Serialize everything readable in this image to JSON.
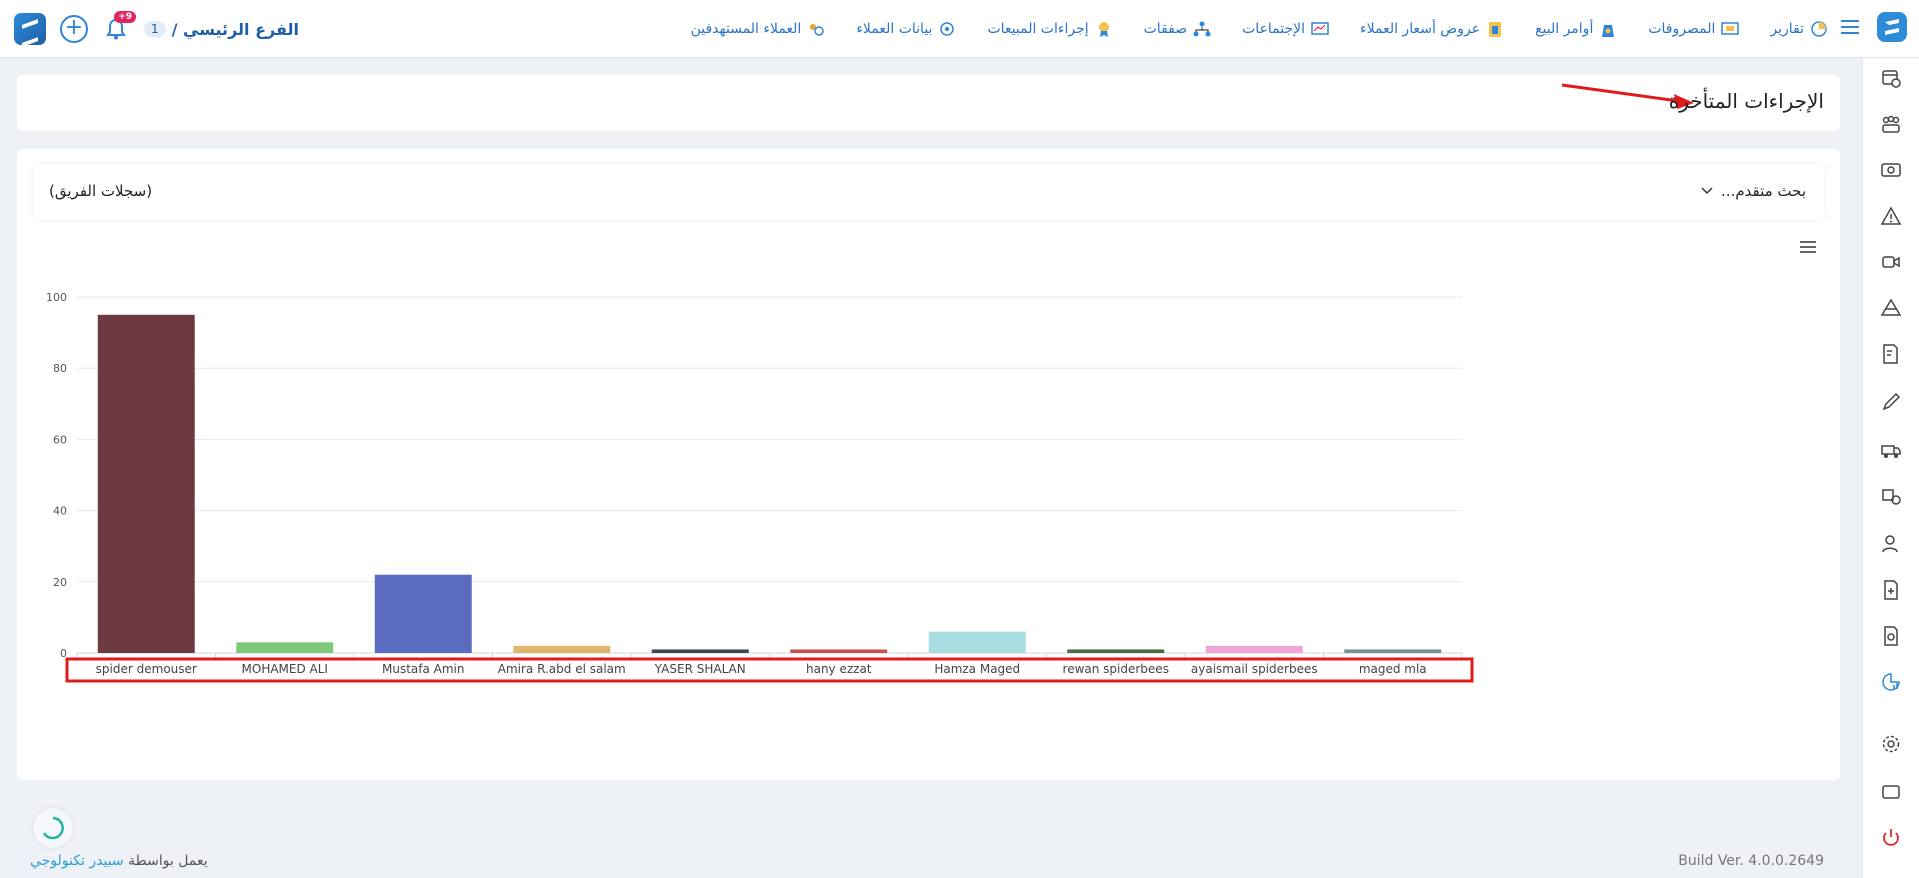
{
  "header": {
    "branch_name": "الفرع الرئيسي /",
    "branch_count": "1",
    "notification_count": "+9",
    "nav": [
      {
        "label": "العملاء المستهدفين",
        "icon": "target-customers-icon"
      },
      {
        "label": "بيانات العملاء",
        "icon": "customer-data-icon"
      },
      {
        "label": "إجراءات المبيعات",
        "icon": "sales-actions-icon"
      },
      {
        "label": "صفقات",
        "icon": "deals-icon"
      },
      {
        "label": "الإجتماعات",
        "icon": "meetings-icon"
      },
      {
        "label": "عروض أسعار العملاء",
        "icon": "quotes-icon"
      },
      {
        "label": "أوامر البيع",
        "icon": "sales-orders-icon"
      },
      {
        "label": "المصروفات",
        "icon": "expenses-icon"
      },
      {
        "label": "تقارير",
        "icon": "reports-icon"
      }
    ]
  },
  "page": {
    "title": "الإجراءات المتأخرة",
    "advanced_search": "بحث متقدم...",
    "team_records": "(سجلات الفريق)"
  },
  "colors": {
    "primary": "#2f86d6",
    "highlight": "#e11b1b"
  },
  "chart_data": {
    "type": "bar",
    "categories": [
      "spider demouser",
      "MOHAMED ALI",
      "Mustafa Amin",
      "Amira R.abd el salam",
      "YASER SHALAN",
      "hany ezzat",
      "Hamza Maged",
      "rewan spiderbees",
      "ayaismail spiderbees",
      "maged mla"
    ],
    "values": [
      95,
      3,
      22,
      2,
      1,
      1,
      6,
      1,
      2,
      1
    ],
    "colors": [
      "#6e3a42",
      "#7fca7a",
      "#5b6bbf",
      "#e0b66d",
      "#3d4650",
      "#c5534d",
      "#a8dde2",
      "#4c6a3e",
      "#efa6d6",
      "#7c9090"
    ],
    "yticks": [
      0,
      20,
      40,
      60,
      80,
      100
    ],
    "ylim": [
      0,
      100
    ],
    "grid": true,
    "xlabel": "",
    "ylabel": "",
    "title": ""
  },
  "footer": {
    "powered_prefix": "يعمل بواسطة ",
    "powered_brand": "سبيدر تكنولوجي",
    "build": "Build Ver. 4.0.0.2649"
  }
}
